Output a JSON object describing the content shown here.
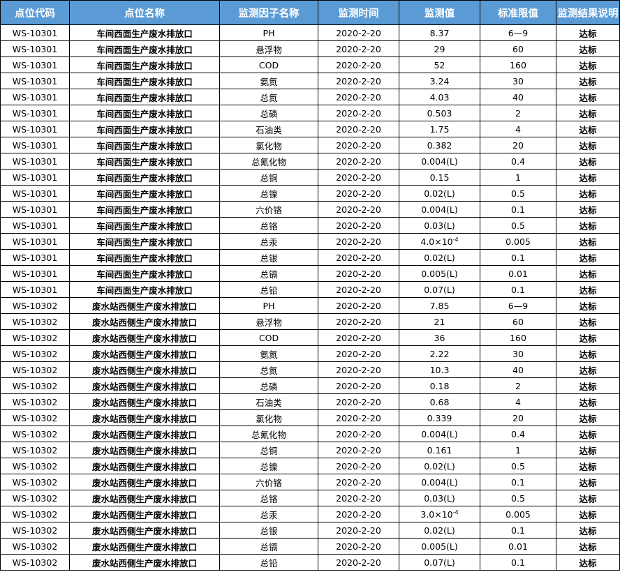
{
  "table": {
    "headers": [
      "点位代码",
      "点位名称",
      "监测因子名称",
      "监测时间",
      "监测值",
      "标准限值",
      "监测结果说明"
    ],
    "rows": [
      {
        "code": "WS-10301",
        "site": "车间西面生产废水排放口",
        "factor": "PH",
        "date": "2020-2-20",
        "value": "8.37",
        "limit": "6—9",
        "result": "达标"
      },
      {
        "code": "WS-10301",
        "site": "车间西面生产废水排放口",
        "factor": "悬浮物",
        "date": "2020-2-20",
        "value": "29",
        "limit": "60",
        "result": "达标"
      },
      {
        "code": "WS-10301",
        "site": "车间西面生产废水排放口",
        "factor": "COD",
        "date": "2020-2-20",
        "value": "52",
        "limit": "160",
        "result": "达标"
      },
      {
        "code": "WS-10301",
        "site": "车间西面生产废水排放口",
        "factor": "氨氮",
        "date": "2020-2-20",
        "value": "3.24",
        "limit": "30",
        "result": "达标"
      },
      {
        "code": "WS-10301",
        "site": "车间西面生产废水排放口",
        "factor": "总氮",
        "date": "2020-2-20",
        "value": "4.03",
        "limit": "40",
        "result": "达标"
      },
      {
        "code": "WS-10301",
        "site": "车间西面生产废水排放口",
        "factor": "总磷",
        "date": "2020-2-20",
        "value": "0.503",
        "limit": "2",
        "result": "达标"
      },
      {
        "code": "WS-10301",
        "site": "车间西面生产废水排放口",
        "factor": "石油类",
        "date": "2020-2-20",
        "value": "1.75",
        "limit": "4",
        "result": "达标"
      },
      {
        "code": "WS-10301",
        "site": "车间西面生产废水排放口",
        "factor": "氯化物",
        "date": "2020-2-20",
        "value": "0.382",
        "limit": "20",
        "result": "达标"
      },
      {
        "code": "WS-10301",
        "site": "车间西面生产废水排放口",
        "factor": "总氰化物",
        "date": "2020-2-20",
        "value": "0.004(L)",
        "limit": "0.4",
        "result": "达标"
      },
      {
        "code": "WS-10301",
        "site": "车间西面生产废水排放口",
        "factor": "总铜",
        "date": "2020-2-20",
        "value": "0.15",
        "limit": "1",
        "result": "达标"
      },
      {
        "code": "WS-10301",
        "site": "车间西面生产废水排放口",
        "factor": "总镍",
        "date": "2020-2-20",
        "value": "0.02(L)",
        "limit": "0.5",
        "result": "达标"
      },
      {
        "code": "WS-10301",
        "site": "车间西面生产废水排放口",
        "factor": "六价铬",
        "date": "2020-2-20",
        "value": "0.004(L)",
        "limit": "0.1",
        "result": "达标"
      },
      {
        "code": "WS-10301",
        "site": "车间西面生产废水排放口",
        "factor": "总铬",
        "date": "2020-2-20",
        "value": "0.03(L)",
        "limit": "0.5",
        "result": "达标"
      },
      {
        "code": "WS-10301",
        "site": "车间西面生产废水排放口",
        "factor": "总汞",
        "date": "2020-2-20",
        "value": "4.0×10",
        "exp": "-4",
        "limit": "0.005",
        "result": "达标"
      },
      {
        "code": "WS-10301",
        "site": "车间西面生产废水排放口",
        "factor": "总银",
        "date": "2020-2-20",
        "value": "0.02(L)",
        "limit": "0.1",
        "result": "达标"
      },
      {
        "code": "WS-10301",
        "site": "车间西面生产废水排放口",
        "factor": "总镉",
        "date": "2020-2-20",
        "value": "0.005(L)",
        "limit": "0.01",
        "result": "达标"
      },
      {
        "code": "WS-10301",
        "site": "车间西面生产废水排放口",
        "factor": "总铅",
        "date": "2020-2-20",
        "value": "0.07(L)",
        "limit": "0.1",
        "result": "达标"
      },
      {
        "code": "WS-10302",
        "site": "废水站西侧生产废水排放口",
        "factor": "PH",
        "date": "2020-2-20",
        "value": "7.85",
        "limit": "6—9",
        "result": "达标"
      },
      {
        "code": "WS-10302",
        "site": "废水站西侧生产废水排放口",
        "factor": "悬浮物",
        "date": "2020-2-20",
        "value": "21",
        "limit": "60",
        "result": "达标"
      },
      {
        "code": "WS-10302",
        "site": "废水站西侧生产废水排放口",
        "factor": "COD",
        "date": "2020-2-20",
        "value": "36",
        "limit": "160",
        "result": "达标"
      },
      {
        "code": "WS-10302",
        "site": "废水站西侧生产废水排放口",
        "factor": "氨氮",
        "date": "2020-2-20",
        "value": "2.22",
        "limit": "30",
        "result": "达标"
      },
      {
        "code": "WS-10302",
        "site": "废水站西侧生产废水排放口",
        "factor": "总氮",
        "date": "2020-2-20",
        "value": "10.3",
        "limit": "40",
        "result": "达标"
      },
      {
        "code": "WS-10302",
        "site": "废水站西侧生产废水排放口",
        "factor": "总磷",
        "date": "2020-2-20",
        "value": "0.18",
        "limit": "2",
        "result": "达标"
      },
      {
        "code": "WS-10302",
        "site": "废水站西侧生产废水排放口",
        "factor": "石油类",
        "date": "2020-2-20",
        "value": "0.68",
        "limit": "4",
        "result": "达标"
      },
      {
        "code": "WS-10302",
        "site": "废水站西侧生产废水排放口",
        "factor": "氯化物",
        "date": "2020-2-20",
        "value": "0.339",
        "limit": "20",
        "result": "达标"
      },
      {
        "code": "WS-10302",
        "site": "废水站西侧生产废水排放口",
        "factor": "总氰化物",
        "date": "2020-2-20",
        "value": "0.004(L)",
        "limit": "0.4",
        "result": "达标"
      },
      {
        "code": "WS-10302",
        "site": "废水站西侧生产废水排放口",
        "factor": "总铜",
        "date": "2020-2-20",
        "value": "0.161",
        "limit": "1",
        "result": "达标"
      },
      {
        "code": "WS-10302",
        "site": "废水站西侧生产废水排放口",
        "factor": "总镍",
        "date": "2020-2-20",
        "value": "0.02(L)",
        "limit": "0.5",
        "result": "达标"
      },
      {
        "code": "WS-10302",
        "site": "废水站西侧生产废水排放口",
        "factor": "六价铬",
        "date": "2020-2-20",
        "value": "0.004(L)",
        "limit": "0.1",
        "result": "达标"
      },
      {
        "code": "WS-10302",
        "site": "废水站西侧生产废水排放口",
        "factor": "总铬",
        "date": "2020-2-20",
        "value": "0.03(L)",
        "limit": "0.5",
        "result": "达标"
      },
      {
        "code": "WS-10302",
        "site": "废水站西侧生产废水排放口",
        "factor": "总汞",
        "date": "2020-2-20",
        "value": "3.0×10",
        "exp": "-4",
        "limit": "0.005",
        "result": "达标"
      },
      {
        "code": "WS-10302",
        "site": "废水站西侧生产废水排放口",
        "factor": "总银",
        "date": "2020-2-20",
        "value": "0.02(L)",
        "limit": "0.1",
        "result": "达标"
      },
      {
        "code": "WS-10302",
        "site": "废水站西侧生产废水排放口",
        "factor": "总镉",
        "date": "2020-2-20",
        "value": "0.005(L)",
        "limit": "0.01",
        "result": "达标"
      },
      {
        "code": "WS-10302",
        "site": "废水站西侧生产废水排放口",
        "factor": "总铅",
        "date": "2020-2-20",
        "value": "0.07(L)",
        "limit": "0.1",
        "result": "达标"
      }
    ]
  }
}
